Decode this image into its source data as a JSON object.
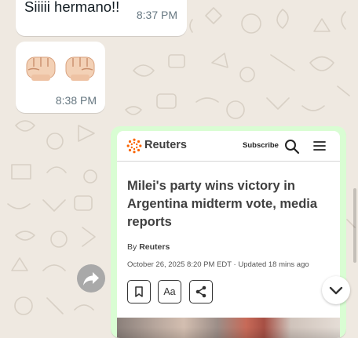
{
  "chat": {
    "messages": [
      {
        "type": "incoming",
        "text": "Siiiii hermano!!",
        "time": "8:37 PM"
      },
      {
        "type": "incoming",
        "emoji": [
          "fist",
          "fist"
        ],
        "time": "8:38 PM"
      }
    ],
    "link_preview": {
      "brand": "Reuters",
      "subscribe_label": "Subscribe",
      "headline": "Milei's party wins victory in Argentina midterm vote, media reports",
      "byline_prefix": "By",
      "byline_author": "Reuters",
      "dateline": "October 26, 2025 8:20 PM EDT · Updated 18 mins ago",
      "tools": {
        "bookmark_icon": "bookmark-icon",
        "text_size_label": "Aa",
        "share_icon": "share-icon"
      }
    }
  },
  "controls": {
    "forward_icon": "forward-icon",
    "scroll_down_icon": "chevron-down-icon"
  },
  "colors": {
    "chat_background": "#efe9e1",
    "incoming_bubble": "#ffffff",
    "outgoing_bubble": "#d9fdd3",
    "brand_orange": "#fa6400",
    "timestamp": "#667781"
  }
}
